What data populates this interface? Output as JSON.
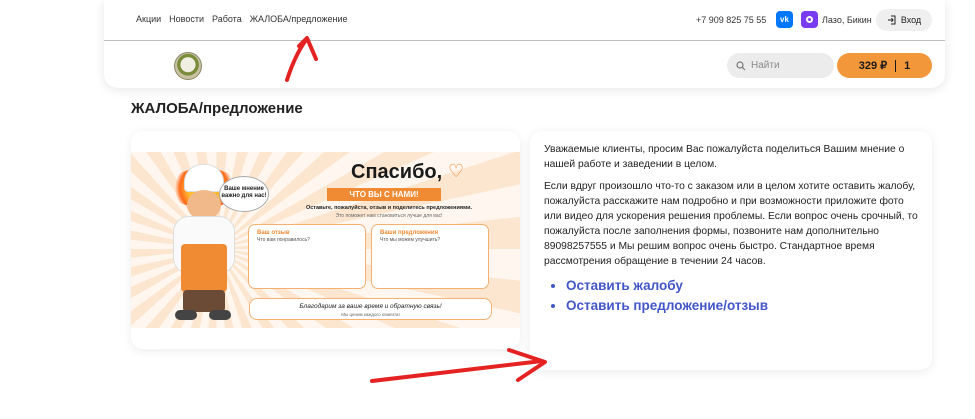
{
  "header": {
    "nav": [
      "Акции",
      "Новости",
      "Работа",
      "ЖАЛОБА/предложение"
    ],
    "phone": "+7 909 825 75 55",
    "vk_label": "vk",
    "city": "Лазо, Бикин",
    "login_label": "Вход",
    "search_placeholder": "Найти",
    "cart_total": "329 ₽",
    "cart_count": "1"
  },
  "page": {
    "title": "ЖАЛОБА/предложение"
  },
  "banner": {
    "bubble": "Ваше мнение важно для нас!",
    "thanks": "Спасибо,",
    "ribbon": "ЧТО ВЫ С НАМИ!",
    "sub1": "Оставьте, пожалуйста, отзыв и поделитесь предложениями.",
    "sub2": "Это поможет нам становиться лучше для вас!",
    "box1_title": "Ваш отзыв",
    "box1_q": "Что вам понравилось?",
    "box2_title": "Ваши предложения",
    "box2_q": "Что мы можем улучшить?",
    "footer": "Благодарим за ваше время и обратную связь!",
    "footer_sub": "Мы ценим каждого клиента!"
  },
  "content": {
    "p1": "Уважаемые клиенты, просим Вас пожалуйста поделиться Вашим мнение о нашей работе и заведении в целом.",
    "p2": "Если вдруг произошло что-то с заказом или в целом хотите оставить жалобу, пожалуйста расскажите нам подробно и при возможности приложите фото или видео для ускорения решения проблемы. Если вопрос очень срочный, то пожалуйста после заполнения формы, позвоните нам дополнительно 89098257555 и Мы решим вопрос очень быстро. Стандартное время рассмотрения обращение в течении 24 часов.",
    "links": [
      "Оставить жалобу",
      "Оставить предложение/отзыв"
    ]
  },
  "colors": {
    "accent": "#f3973b",
    "link": "#4356c9",
    "annotation_arrow": "#e52222"
  }
}
